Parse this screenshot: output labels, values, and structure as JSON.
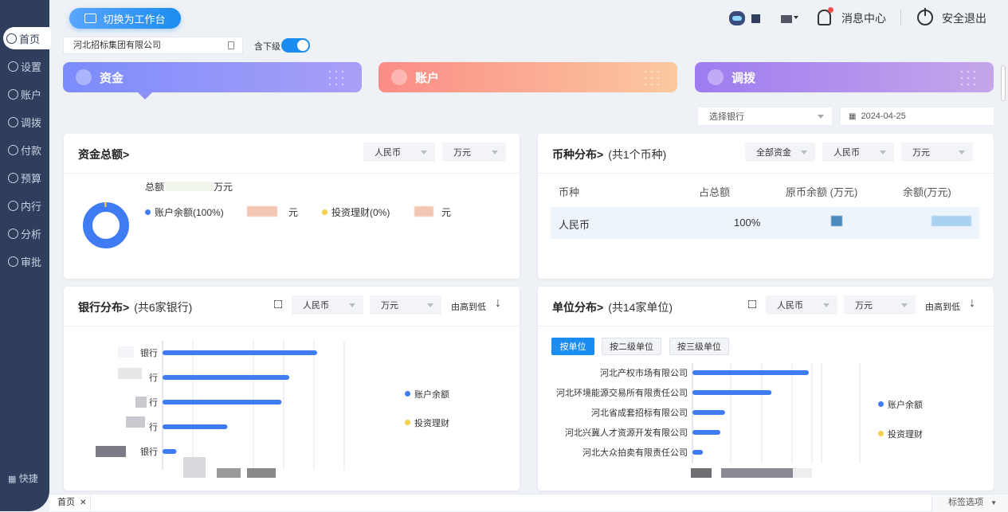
{
  "header": {
    "switch_label": "切换为工作台",
    "company": "河北招标集团有限公司",
    "sub_label": "含下级",
    "msg_label": "消息中心",
    "logout_label": "安全退出"
  },
  "sidebar": {
    "items": [
      {
        "label": "首页",
        "icon": "home-icon"
      },
      {
        "label": "设置",
        "icon": "gear-icon"
      },
      {
        "label": "账户",
        "icon": "account-icon"
      },
      {
        "label": "调拨",
        "icon": "transfer-icon"
      },
      {
        "label": "付款",
        "icon": "payment-icon"
      },
      {
        "label": "预算",
        "icon": "budget-icon"
      },
      {
        "label": "内行",
        "icon": "bank-icon"
      },
      {
        "label": "分析",
        "icon": "chart-icon"
      },
      {
        "label": "审批",
        "icon": "approve-icon"
      }
    ],
    "quick": "快捷"
  },
  "categories": [
    {
      "label": "资金"
    },
    {
      "label": "账户"
    },
    {
      "label": "调拨"
    }
  ],
  "filters": {
    "bank_placeholder": "选择银行",
    "date": "2024-04-25"
  },
  "funds": {
    "title": "资金总额>",
    "currency": "人民币",
    "unit": "万元",
    "total_prefix": "总额",
    "total_suffix": "万元",
    "legend1": "账户余额(100%)",
    "legend2": "投资理财(0%)",
    "suffix1": "元",
    "suffix2": "元",
    "colors": {
      "balance": "#3f7cf4",
      "invest": "#f5d04a"
    }
  },
  "currency": {
    "title": "币种分布>",
    "sub": "(共1个币种)",
    "scope": "全部资金",
    "currency": "人民币",
    "unit": "万元",
    "headers": [
      "币种",
      "占总额",
      "原币余额 (万元)",
      "余额(万元)"
    ],
    "row": {
      "name": "人民币",
      "pct": "100%"
    }
  },
  "bank": {
    "title": "银行分布>",
    "sub": "(共6家银行)",
    "currency": "人民币",
    "unit": "万元",
    "order": "由高到低",
    "labels": [
      "银行",
      "行",
      "行",
      "行",
      "银行"
    ],
    "values": [
      1.0,
      0.82,
      0.77,
      0.42,
      0.09
    ],
    "legend1": "账户余额",
    "legend2": "投资理财"
  },
  "unit": {
    "title": "单位分布>",
    "sub": "(共14家单位)",
    "currency": "人民币",
    "unit": "万元",
    "order": "由高到低",
    "segments": [
      "按单位",
      "按二级单位",
      "按三级单位"
    ],
    "labels": [
      "河北产权市场有限公司",
      "河北环境能源交易所有限责任公司",
      "河北省成套招标有限公司",
      "河北兴冀人才资源开发有限公司",
      "河北大众拍卖有限责任公司"
    ],
    "values": [
      1.0,
      0.68,
      0.28,
      0.24,
      0.09
    ],
    "legend1": "账户余额",
    "legend2": "投资理财"
  },
  "tabs": {
    "home": "首页",
    "options": "标签选项"
  }
}
